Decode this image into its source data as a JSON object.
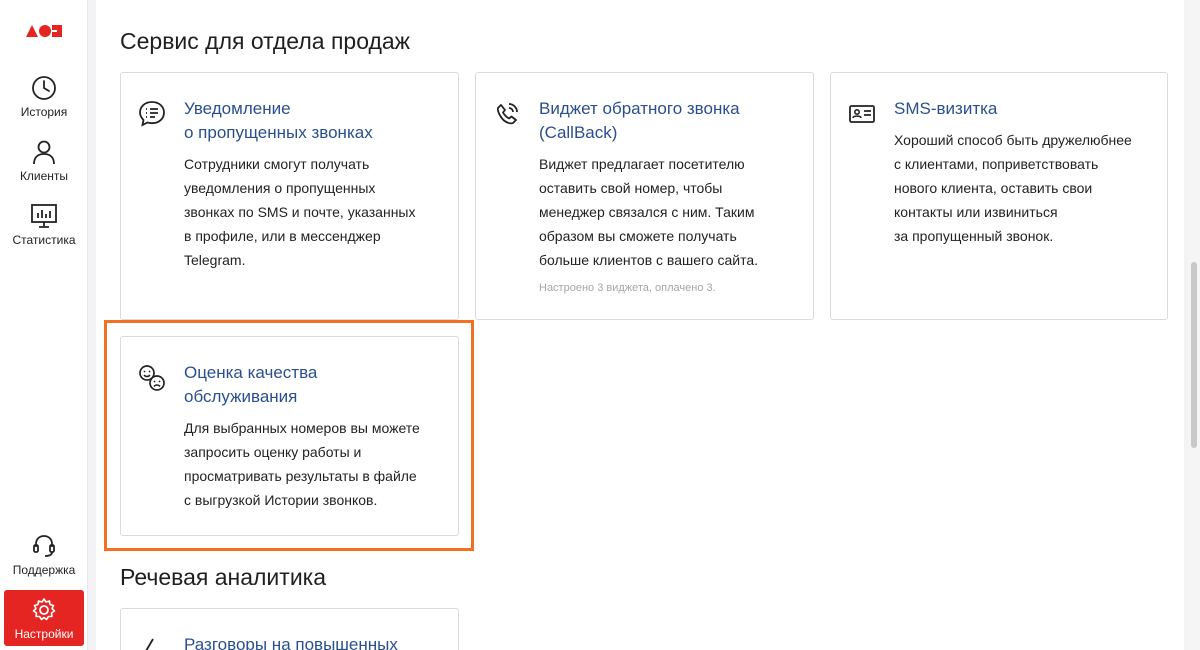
{
  "sidebar": {
    "items": [
      {
        "label": "История",
        "icon": "clock-icon"
      },
      {
        "label": "Клиенты",
        "icon": "user-icon"
      },
      {
        "label": "Статистика",
        "icon": "chart-icon"
      }
    ],
    "bottom": [
      {
        "label": "Поддержка",
        "icon": "headset-icon"
      },
      {
        "label": "Настройки",
        "icon": "gear-icon",
        "active": true
      }
    ]
  },
  "colors": {
    "brand": "#e52521",
    "link": "#2a4f8f",
    "highlight": "#f37021"
  },
  "sales": {
    "title": "Сервис для отдела продаж",
    "cards": [
      {
        "icon": "chat-lines-icon",
        "title_lines": [
          "Уведомление",
          "о пропущенных звонках"
        ],
        "desc_lines": [
          "Сотрудники смогут получать",
          "уведомления о пропущенных",
          "звонках по SMS и почте, указанных",
          "в профиле, или в мессенджер",
          "Telegram."
        ]
      },
      {
        "icon": "phone-callback-icon",
        "title_lines": [
          "Виджет обратного звонка",
          "(CallBack)"
        ],
        "desc_lines": [
          "Виджет предлагает посетителю",
          "оставить свой номер, чтобы",
          "менеджер связался с ним. Таким",
          "образом вы сможете получать",
          "больше клиентов с вашего сайта."
        ],
        "note": "Настроено 3 виджета, оплачено 3."
      },
      {
        "icon": "id-card-icon",
        "title_lines": [
          "SMS-визитка"
        ],
        "desc_lines": [
          "Хороший способ быть дружелюбнее",
          "с клиентами, поприветствовать",
          "нового клиента, оставить свои",
          "контакты или извиниться",
          "за пропущенный звонок."
        ]
      },
      {
        "icon": "smile-sad-icon",
        "title_lines": [
          "Оценка качества",
          "обслуживания"
        ],
        "desc_lines": [
          "Для выбранных номеров вы можете",
          "запросить оценку работы и",
          "просматривать результаты в файле",
          "с выгрузкой Истории звонков."
        ]
      }
    ]
  },
  "speech": {
    "title": "Речевая аналитика",
    "cards": [
      {
        "icon": "lightning-icon",
        "title_lines": [
          "Разговоры на повышенных"
        ]
      }
    ]
  }
}
